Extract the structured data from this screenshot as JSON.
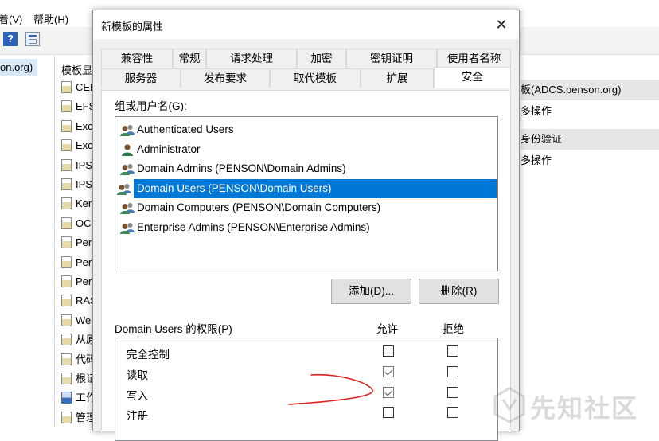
{
  "background_window": {
    "menu": [
      "着(V)",
      "帮助(H)"
    ],
    "left_pane_item": "on.org)",
    "list_header": "模板显",
    "list_rows": [
      {
        "text": "CEF",
        "icon": "template-icon"
      },
      {
        "text": "EFS",
        "icon": "template-icon"
      },
      {
        "text": "Exc",
        "icon": "template-icon"
      },
      {
        "text": "Exc",
        "icon": "template-icon"
      },
      {
        "text": "IPS",
        "icon": "template-icon"
      },
      {
        "text": "IPS",
        "icon": "template-icon"
      },
      {
        "text": "Ker",
        "icon": "template-icon"
      },
      {
        "text": "OC",
        "icon": "template-icon"
      },
      {
        "text": "Per",
        "icon": "template-icon"
      },
      {
        "text": "Per",
        "icon": "template-icon"
      },
      {
        "text": "Per",
        "icon": "template-icon"
      },
      {
        "text": "RAS",
        "icon": "template-icon"
      },
      {
        "text": "We",
        "icon": "template-icon"
      },
      {
        "text": "从原",
        "icon": "template-icon"
      },
      {
        "text": "代码",
        "icon": "template-icon"
      },
      {
        "text": "根证",
        "icon": "template-icon"
      },
      {
        "text": "工作",
        "icon": "template-blue-icon"
      },
      {
        "text": "管理",
        "icon": "template-icon"
      }
    ],
    "actions": {
      "header1": "板(ADCS.penson.org)",
      "item1": "多操作",
      "header2": "身份验证",
      "item2": "多操作"
    }
  },
  "dialog": {
    "title": "新模板的属性",
    "close_symbol": "✕",
    "tabs_row1": [
      "兼容性",
      "常规",
      "请求处理",
      "加密",
      "密钥证明",
      "使用者名称"
    ],
    "tabs_row2": [
      "服务器",
      "发布要求",
      "取代模板",
      "扩展",
      "安全"
    ],
    "active_tab": "安全",
    "group_label": "组或用户名(G):",
    "users": [
      {
        "name": "Authenticated Users",
        "icon": "user-group-icon",
        "selected": false
      },
      {
        "name": "Administrator",
        "icon": "user-icon",
        "selected": false
      },
      {
        "name": "Domain Admins (PENSON\\Domain Admins)",
        "icon": "user-group-icon",
        "selected": false
      },
      {
        "name": "Domain Users (PENSON\\Domain Users)",
        "icon": "user-group-icon",
        "selected": true
      },
      {
        "name": "Domain Computers (PENSON\\Domain Computers)",
        "icon": "user-group-icon",
        "selected": false
      },
      {
        "name": "Enterprise Admins (PENSON\\Enterprise Admins)",
        "icon": "user-group-icon",
        "selected": false
      }
    ],
    "add_button": "添加(D)...",
    "remove_button": "删除(R)",
    "permissions_label": "Domain Users 的权限(P)",
    "allow_header": "允许",
    "deny_header": "拒绝",
    "permissions": [
      {
        "name": "完全控制",
        "allow": false,
        "deny": false
      },
      {
        "name": "读取",
        "allow": true,
        "deny": false
      },
      {
        "name": "写入",
        "allow": true,
        "deny": false
      },
      {
        "name": "注册",
        "allow": false,
        "deny": false
      }
    ]
  },
  "annotation": {
    "color": "#e02020"
  },
  "watermark": {
    "text": "先知社区"
  },
  "colors": {
    "selection": "#0078d7",
    "dialog_bg": "#f0f0f0"
  }
}
